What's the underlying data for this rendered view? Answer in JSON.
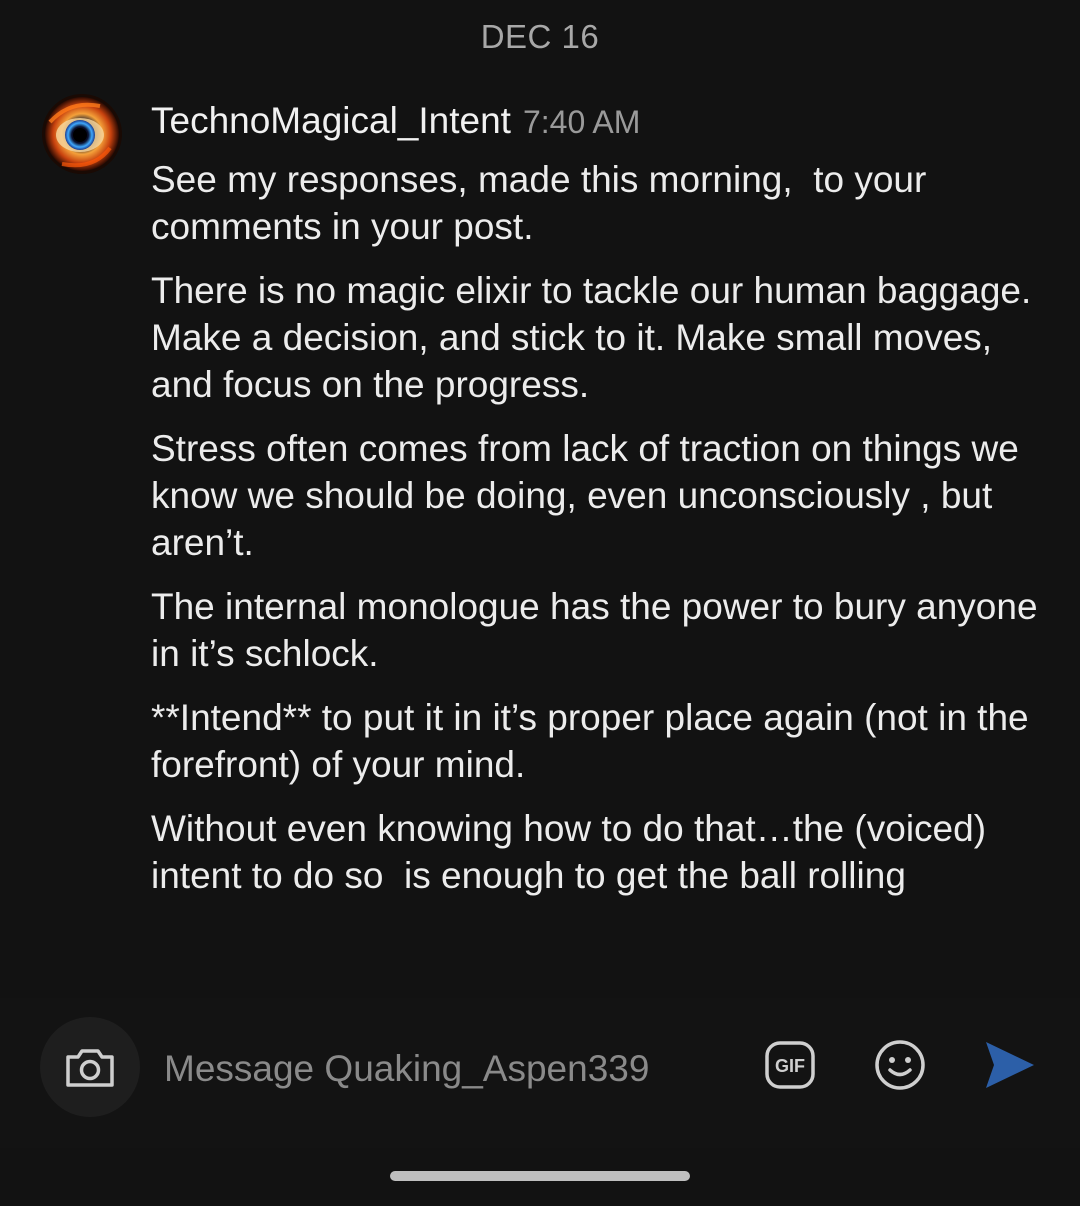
{
  "date_separator": "DEC 16",
  "message": {
    "username": "TechnoMagical_Intent",
    "timestamp": "7:40 AM",
    "avatar_icon": "eye-vortex-avatar",
    "paragraphs": [
      "See my responses, made this morning,  to your comments in your post.",
      "There is no magic elixir to tackle our human baggage. Make a decision, and stick to it. Make small moves, and focus on the progress.",
      "Stress often comes from lack of traction on things we know we should be doing, even unconsciously , but aren’t.",
      "The internal monologue has the power to bury anyone in it’s schlock.",
      "**Intend** to put it in it’s proper place again (not in the forefront) of your mind.",
      "Without even knowing how to do that…the (voiced) intent to do so  is enough to get the ball rolling"
    ]
  },
  "composer": {
    "placeholder": "Message Quaking_Aspen339",
    "camera_icon": "camera-icon",
    "gif_label": "GIF",
    "emoji_icon": "smiley-icon",
    "send_icon": "send-icon",
    "send_color": "#2c5fa8"
  }
}
